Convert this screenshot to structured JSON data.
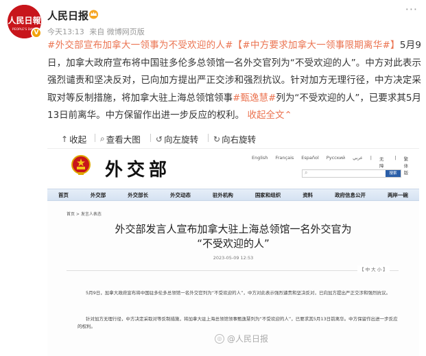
{
  "post": {
    "author": "人民日报",
    "avatar_text": "人民日報",
    "avatar_subtext": "PEOPLE'S DAILY",
    "verified_badge": "V",
    "time": "今天13:13",
    "source": "来自 微博网页版",
    "more": "···",
    "text": {
      "topic1": "#外交部宣布加拿大一领事为不受欢迎的人#",
      "topic2": "【#中方要求加拿大一领事限期离华#】",
      "body1": "5月9日，加拿大政府宣布将中国驻多伦多总领馆一名外交官列为“不受欢迎的人”。中方对此表示强烈谴责和坚决反对，已向加方提出严正交涉和强烈抗议。针对加方无理行径，中方决定采取对等反制措施，将加拿大驻上海总领馆领事",
      "topic3": "#甄逸慧#",
      "body2": "列为“不受欢迎的人”，已要求其5月13日前离华。中方保留作出进一步反应的权利。",
      "collapse": "收起全文",
      "collapse_arrow": "⌃"
    }
  },
  "toolbar": {
    "collapse": {
      "icon": "↑",
      "label": "收起"
    },
    "view_large": {
      "icon": "⌕",
      "label": "查看大图"
    },
    "rotate_left": {
      "icon": "↺",
      "label": "向左旋转"
    },
    "rotate_right": {
      "icon": "↻",
      "label": "向右旋转"
    }
  },
  "image": {
    "site_name": "外交部",
    "languages": [
      "English",
      "Français",
      "Español",
      "Русский",
      "عربي",
      "|",
      "无障碍",
      "|",
      "繁体版"
    ],
    "search_button": "搜索",
    "nav": [
      "首页",
      "外交部",
      "外交部长",
      "外交动态",
      "驻外机构",
      "国家和组织",
      "资料",
      "政府信息公开",
      "两岸一碗"
    ],
    "breadcrumb": "首页 > 发言人表态",
    "title_line1": "外交部发言人宣布加拿大驻上海总领馆一名外交官为",
    "title_line2": "“不受欢迎的人”",
    "date": "2023-05-09 12:53",
    "font_size": "【 中  大  小 】",
    "para1": "5月9日，加拿大政府宣布将中国驻多伦多总领馆一名外交官列为“不受欢迎的人”，中方对此表示强烈谴责和坚决反对，已向加方提出严正交涉和强烈抗议。",
    "para2": "针对加方无理行径，中方决定采取对等反制措施，将加拿大驻上海总领馆领事甄逸慧列为“不受欢迎的人”，已要求其5月13日前离华。中方保留作出进一步反应的权利。",
    "watermark": "@人民日报"
  }
}
